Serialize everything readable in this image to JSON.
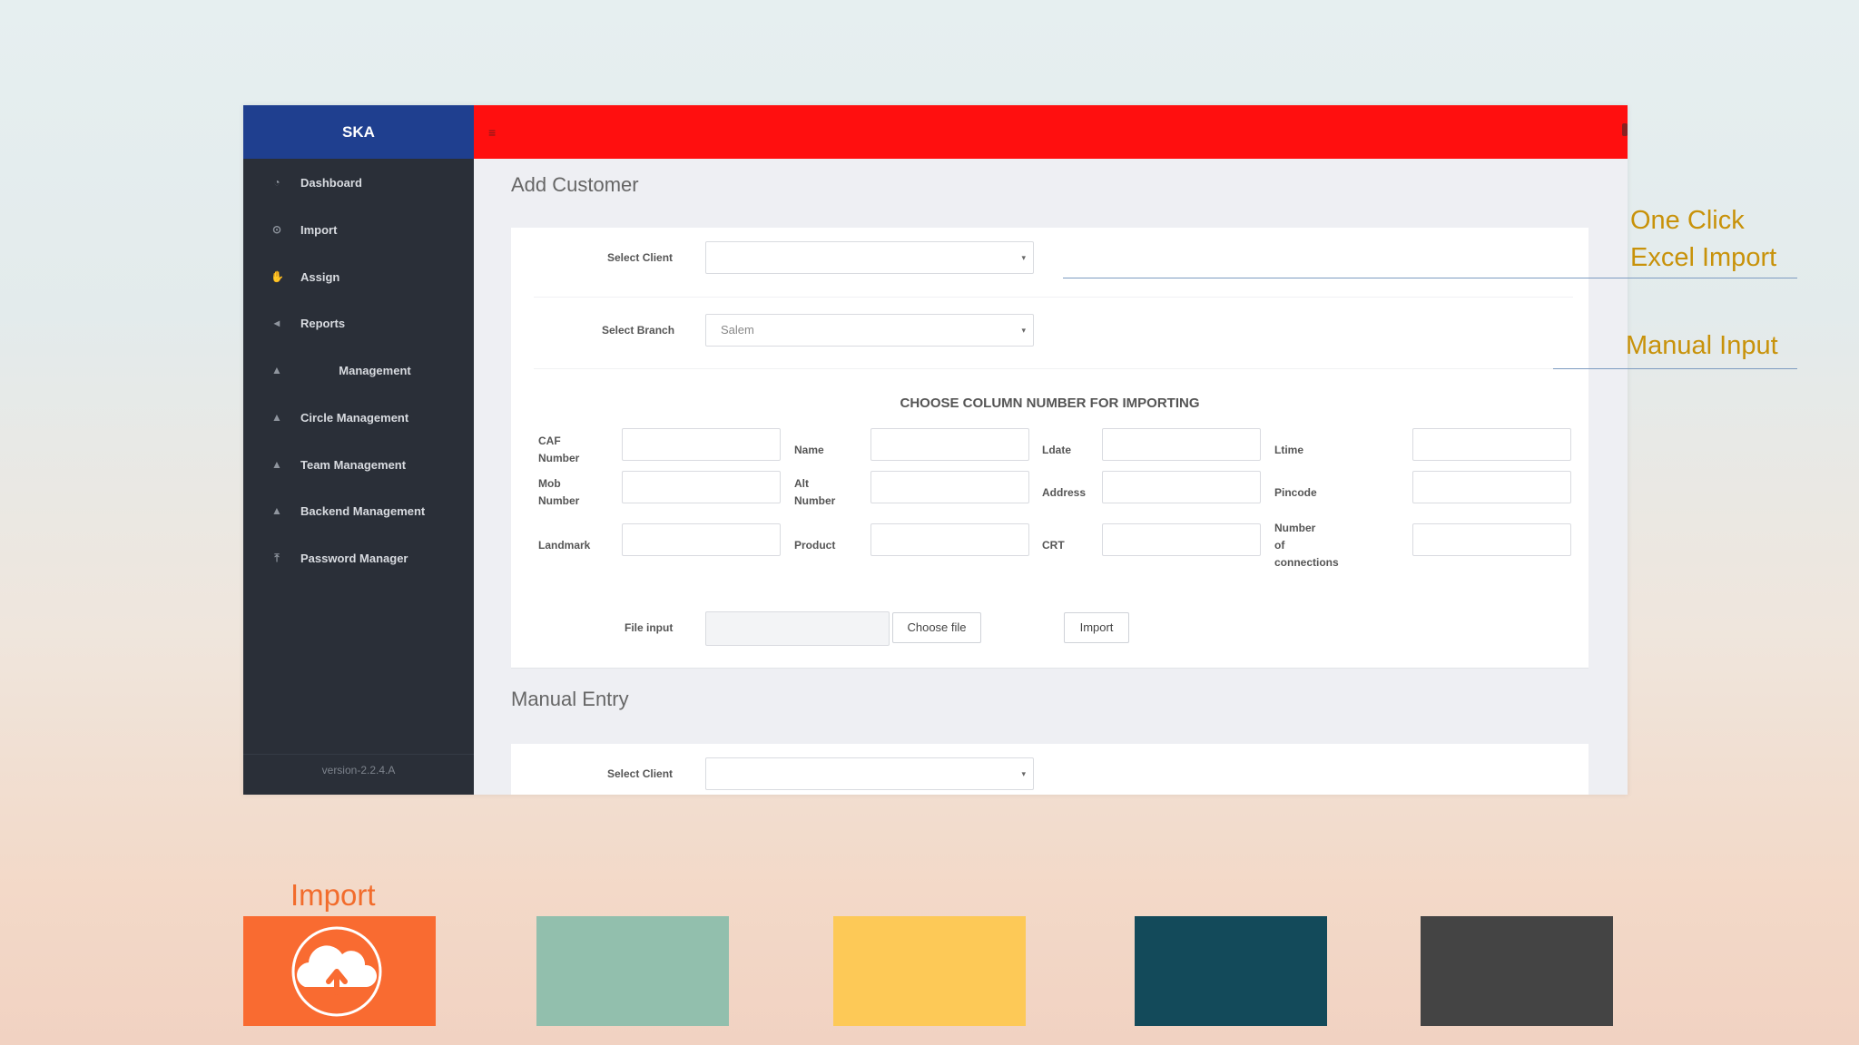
{
  "app": {
    "brand": "SKA",
    "version": "version-2.2.4.A"
  },
  "sidebar": {
    "items": [
      {
        "label": "Dashboard",
        "icon": "dashboard-icon",
        "glyph": "◔"
      },
      {
        "label": "Import",
        "icon": "import-icon",
        "glyph": "⊙"
      },
      {
        "label": "Assign",
        "icon": "thumbs-up-icon",
        "glyph": "✋"
      },
      {
        "label": "Reports",
        "icon": "megaphone-icon",
        "glyph": "◂"
      },
      {
        "label": "Management",
        "icon": "user-icon",
        "glyph": "▲"
      },
      {
        "label": "Circle Management",
        "icon": "user-icon",
        "glyph": "▲"
      },
      {
        "label": "Team Management",
        "icon": "users-icon",
        "glyph": "▲"
      },
      {
        "label": "Backend Management",
        "icon": "users-icon",
        "glyph": "▲"
      },
      {
        "label": "Password Manager",
        "icon": "upload-icon",
        "glyph": "⤒"
      }
    ]
  },
  "topbar": {
    "menu_glyph": "≡"
  },
  "add_customer": {
    "title": "Add Customer",
    "select_client_label": "Select Client",
    "select_client_value": "",
    "select_branch_label": "Select Branch",
    "select_branch_value": "Salem",
    "section_title": "CHOOSE COLUMN NUMBER FOR IMPORTING",
    "fields": {
      "caf": "CAF\nNumber",
      "name": "Name",
      "ldate": "Ldate",
      "ltime": "Ltime",
      "mob": "Mob\nNumber",
      "alt": "Alt\nNumber",
      "address": "Address",
      "pincode": "Pincode",
      "landmark": "Landmark",
      "product": "Product",
      "crt": "CRT",
      "connections": "Number\nof\nconnections"
    },
    "file_input_label": "File input",
    "choose_file": "Choose file",
    "import_button": "Import"
  },
  "manual_entry": {
    "title": "Manual Entry",
    "select_client_label": "Select Client",
    "select_client_value": ""
  },
  "caret": "▾",
  "annotations": {
    "one_click_line1": "One Click",
    "one_click_line2": "Excel Import",
    "manual_input": "Manual Input"
  },
  "bottom": {
    "import_label": "Import",
    "tile_colors": [
      "#f96b31",
      "#92bfad",
      "#fdc957",
      "#134a5a",
      "#444444"
    ],
    "upload_icon": "cloud-upload-icon"
  }
}
